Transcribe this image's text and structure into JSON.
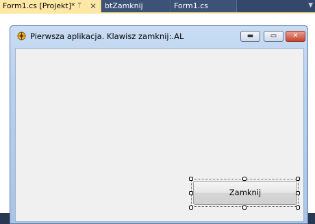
{
  "tabs": [
    {
      "label": "Form1.cs [Projekt]*",
      "active": true
    },
    {
      "label": "btZamknij",
      "active": false
    },
    {
      "label": "Form1.cs",
      "active": false
    }
  ],
  "tab_controls": {
    "pin_icon": "pin-icon",
    "close_icon": "close-icon",
    "close_glyph": "✕",
    "pin_glyph": "ᛘ",
    "dropdown_glyph": "▼"
  },
  "form": {
    "title": "Pierwsza aplikacja. Klawisz zamknij:.AL",
    "icon": "app-icon",
    "caption_buttons": {
      "minimize": "▬",
      "maximize": "▭",
      "close": "✕"
    }
  },
  "button": {
    "label": "Zamknij"
  },
  "colors": {
    "active_tab": "#ffe8a6",
    "tab_strip": "#2f4468",
    "client_area": "#f0f0f0"
  }
}
